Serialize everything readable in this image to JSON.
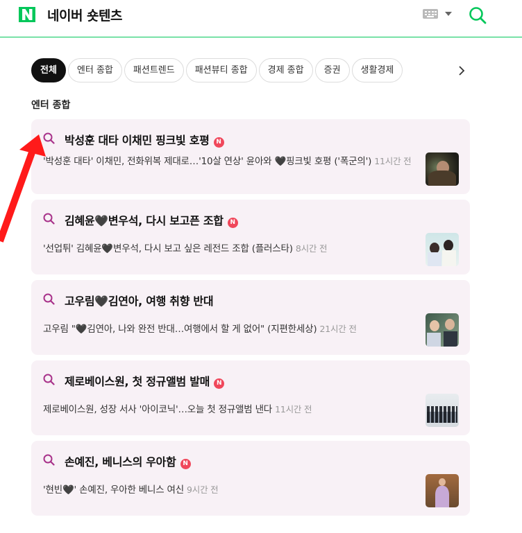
{
  "header": {
    "logo_letter": "N",
    "title": "네이버 숏텐츠",
    "brand_color": "#03c75a",
    "keyboard_icon": "keyboard-icon",
    "search_icon": "search-icon"
  },
  "tabs": [
    {
      "label": "전체",
      "active": true
    },
    {
      "label": "엔터 종합",
      "active": false
    },
    {
      "label": "패션트렌드",
      "active": false
    },
    {
      "label": "패션뷰티 종합",
      "active": false
    },
    {
      "label": "경제 종합",
      "active": false
    },
    {
      "label": "증권",
      "active": false
    },
    {
      "label": "생활경제",
      "active": false
    }
  ],
  "section": {
    "title": "엔터 종합"
  },
  "cards": [
    {
      "title": "박성훈 대타 이채민 핑크빛 호평",
      "new_badge": "N",
      "desc": "'박성훈 대타' 이채민, 전화위복 제대로…'10살 연상' 윤아와 🖤핑크빛 호평 ('폭군의')",
      "time": "11시간 전"
    },
    {
      "title": "김혜윤🖤변우석, 다시 보고픈 조합",
      "new_badge": "N",
      "desc": "'선업튀' 김혜윤🖤변우석, 다시 보고 싶은 레전드 조합 (플러스타)",
      "time": "8시간 전"
    },
    {
      "title": "고우림🖤김연아, 여행 취향 반대",
      "new_badge": "",
      "desc": "고우림 \"🖤김연아, 나와 완전 반대…여행에서 할 게 없어\" (지편한세상)",
      "time": "21시간 전"
    },
    {
      "title": "제로베이스원, 첫 정규앨범 발매",
      "new_badge": "N",
      "desc": "제로베이스원, 성장 서사 '아이코닉'…오늘 첫 정규앨범 낸다",
      "time": "11시간 전"
    },
    {
      "title": "손예진, 베니스의 우아함",
      "new_badge": "N",
      "desc": "'현빈🖤' 손예진, 우아한 베니스 여신",
      "time": "9시간 전"
    }
  ],
  "colors": {
    "accent": "#03c75a",
    "card_bg": "#f8f1f6",
    "badge": "#f0475b",
    "arrow": "#ff1a1a",
    "search_q": "#a8328a"
  }
}
